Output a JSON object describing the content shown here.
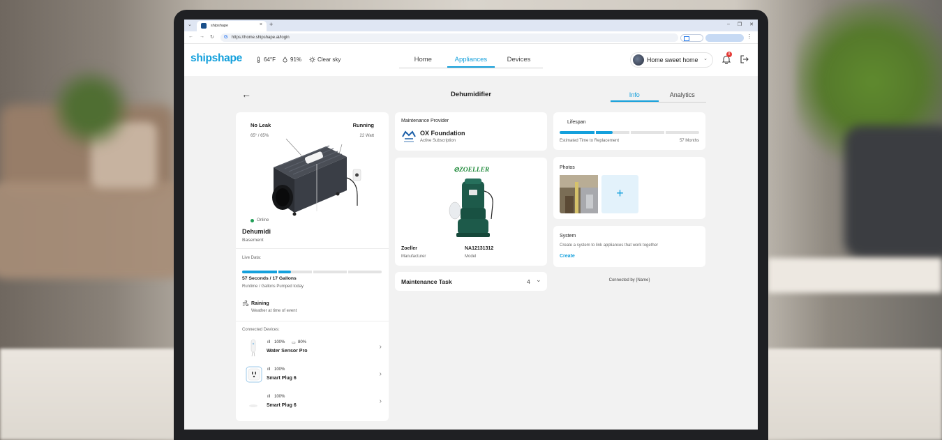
{
  "browser": {
    "tab_title": "shipshape",
    "url": "https://home.shipshape.ai/login"
  },
  "app": {
    "logo": "shipshape",
    "weather": {
      "temp": "64°F",
      "humidity": "91%",
      "condition": "Clear sky"
    },
    "nav": [
      "Home",
      "Appliances",
      "Devices"
    ],
    "home_selector": "Home sweet home",
    "notification_count": "8"
  },
  "page": {
    "title": "Dehumidifier",
    "tabs": [
      "Info",
      "Analytics"
    ]
  },
  "appliance": {
    "leak_status": "No Leak",
    "leak_reading": "65° / 65%",
    "run_status": "Running",
    "power": "22 Watt",
    "online": "Online",
    "name": "Dehumidi",
    "location": "Basement",
    "live_data_label": "Live Data:",
    "live_value": "57 Seconds / 17 Gallons",
    "live_caption": "Runtime / Gallons Pumped today",
    "live_progress": 0.35,
    "weather_event": "Raining",
    "weather_caption": "Weather at time of event",
    "connected_label": "Connected Devices:",
    "devices": [
      {
        "name": "Water Sensor Pro",
        "signal": "100%",
        "battery": "80%"
      },
      {
        "name": "Smart Plug 6",
        "signal": "100%"
      },
      {
        "name": "Smart Plug 6",
        "signal": "100%"
      }
    ]
  },
  "maintenance": {
    "label": "Maintenance Provider",
    "provider": "OX Foundation",
    "subscription": "Active Subscription"
  },
  "product": {
    "brand_logo": "ZOELLER",
    "manufacturer": "Zoeller",
    "manufacturer_label": "Manufacturer",
    "model": "NA12131312",
    "model_label": "Model"
  },
  "maintenance_task": {
    "label": "Maintenance Task",
    "count": "4"
  },
  "lifespan": {
    "label": "Lifespan",
    "caption": "Estimated Time to Replacement",
    "value": "57 Months",
    "progress": 0.38
  },
  "photos": {
    "label": "Photos",
    "add": "+"
  },
  "system": {
    "label": "System",
    "description": "Create a system to link appliances that work together",
    "action": "Create"
  },
  "footer": {
    "connected_by": "Connected by {Name}"
  },
  "colors": {
    "accent": "#14a0dc",
    "online": "#1f9d55",
    "zoeller_green": "#1f8a3a"
  }
}
